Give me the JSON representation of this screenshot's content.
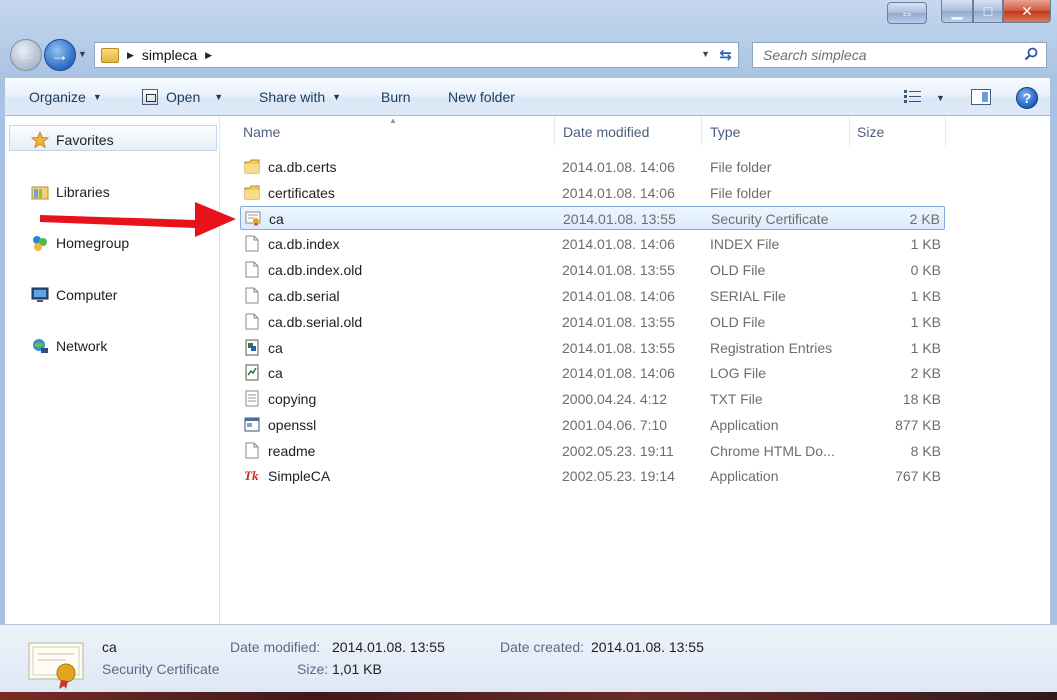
{
  "window": {
    "caption_buttons": {
      "resize": "⇔",
      "minimize": "▁",
      "maximize": "□",
      "close": "✕"
    }
  },
  "address_bar": {
    "crumbs": [
      "simpleca"
    ],
    "search_placeholder": "Search simpleca"
  },
  "toolbar": {
    "organize": "Organize",
    "open": "Open",
    "share_with": "Share with",
    "burn": "Burn",
    "new_folder": "New folder",
    "help": "?"
  },
  "nav_pane": {
    "items": [
      {
        "label": "Favorites",
        "icon": "star-icon"
      },
      {
        "label": "Libraries",
        "icon": "libraries-icon"
      },
      {
        "label": "Homegroup",
        "icon": "homegroup-icon"
      },
      {
        "label": "Computer",
        "icon": "computer-icon"
      },
      {
        "label": "Network",
        "icon": "network-icon"
      }
    ]
  },
  "columns": {
    "name": "Name",
    "date": "Date modified",
    "type": "Type",
    "size": "Size"
  },
  "files": [
    {
      "name": "ca.db.certs",
      "date": "2014.01.08. 14:06",
      "type": "File folder",
      "size": "",
      "icon": "folder-icon"
    },
    {
      "name": "certificates",
      "date": "2014.01.08. 14:06",
      "type": "File folder",
      "size": "",
      "icon": "folder-icon"
    },
    {
      "name": "ca",
      "date": "2014.01.08. 13:55",
      "type": "Security Certificate",
      "size": "2 KB",
      "icon": "certificate-icon",
      "selected": true
    },
    {
      "name": "ca.db.index",
      "date": "2014.01.08. 14:06",
      "type": "INDEX File",
      "size": "1 KB",
      "icon": "file-icon"
    },
    {
      "name": "ca.db.index.old",
      "date": "2014.01.08. 13:55",
      "type": "OLD File",
      "size": "0 KB",
      "icon": "file-icon"
    },
    {
      "name": "ca.db.serial",
      "date": "2014.01.08. 14:06",
      "type": "SERIAL File",
      "size": "1 KB",
      "icon": "file-icon"
    },
    {
      "name": "ca.db.serial.old",
      "date": "2014.01.08. 13:55",
      "type": "OLD File",
      "size": "1 KB",
      "icon": "file-icon"
    },
    {
      "name": "ca",
      "date": "2014.01.08. 13:55",
      "type": "Registration Entries",
      "size": "1 KB",
      "icon": "registry-icon"
    },
    {
      "name": "ca",
      "date": "2014.01.08. 14:06",
      "type": "LOG File",
      "size": "2 KB",
      "icon": "log-file-icon"
    },
    {
      "name": "copying",
      "date": "2000.04.24. 4:12",
      "type": "TXT File",
      "size": "18 KB",
      "icon": "text-file-icon"
    },
    {
      "name": "openssl",
      "date": "2001.04.06. 7:10",
      "type": "Application",
      "size": "877 KB",
      "icon": "application-icon"
    },
    {
      "name": "readme",
      "date": "2002.05.23. 19:11",
      "type": "Chrome HTML Do...",
      "size": "8 KB",
      "icon": "file-icon"
    },
    {
      "name": "SimpleCA",
      "date": "2002.05.23. 19:14",
      "type": "Application",
      "size": "767 KB",
      "icon": "tk-app-icon"
    }
  ],
  "details": {
    "name": "ca",
    "type": "Security Certificate",
    "date_modified_label": "Date modified:",
    "date_modified": "2014.01.08. 13:55",
    "date_created_label": "Date created:",
    "date_created": "2014.01.08. 13:55",
    "size_label": "Size:",
    "size": "1,01 KB"
  },
  "colors": {
    "selection": "#d9ebfc",
    "selection_border": "#84acdd",
    "annotation_arrow": "#e8121a"
  }
}
